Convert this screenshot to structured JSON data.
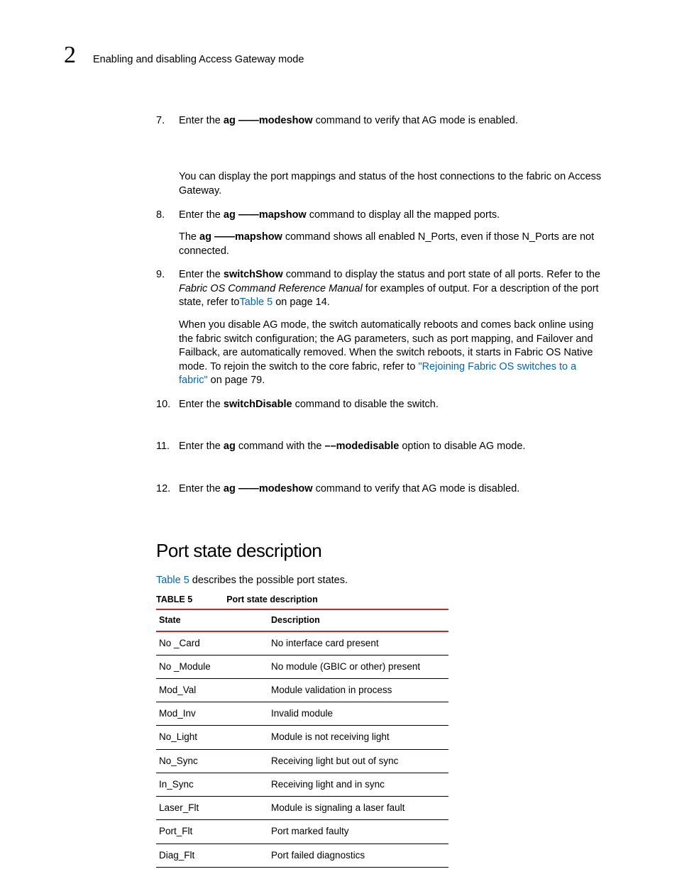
{
  "chapterNumber": "2",
  "headerTitle": "Enabling and disabling Access Gateway mode",
  "steps": [
    {
      "num": "7.",
      "paras": [
        [
          {
            "t": "Enter the "
          },
          {
            "t": "ag ",
            "cls": "bold"
          },
          {
            "t": "——modeshow",
            "cls": "bold"
          },
          {
            "t": " command to verify that AG mode is enabled."
          }
        ],
        [
          {
            "t": "You can display the port mappings and status of the host connections to the fabric on Access Gateway."
          }
        ]
      ],
      "gapAfterFirst": true
    },
    {
      "num": "8.",
      "paras": [
        [
          {
            "t": "Enter the "
          },
          {
            "t": "ag ",
            "cls": "bold"
          },
          {
            "t": "——mapshow",
            "cls": "bold"
          },
          {
            "t": " command to display all the mapped ports."
          }
        ],
        [
          {
            "t": "The "
          },
          {
            "t": "ag ",
            "cls": "bold"
          },
          {
            "t": "——mapshow",
            "cls": "bold"
          },
          {
            "t": " command shows all enabled N_Ports, even if those N_Ports are not connected."
          }
        ]
      ]
    },
    {
      "num": "9.",
      "paras": [
        [
          {
            "t": "Enter the "
          },
          {
            "t": "switchShow",
            "cls": "bold"
          },
          {
            "t": " command to display the status and port state of all ports. Refer to the "
          },
          {
            "t": "Fabric OS Command Reference Manual",
            "cls": "italic"
          },
          {
            "t": " for examples of output. For a description of the port state, refer to"
          },
          {
            "t": "Table 5",
            "cls": "link"
          },
          {
            "t": " on page 14."
          }
        ],
        [
          {
            "t": "When you disable AG mode, the switch automatically reboots and comes back online using the fabric switch configuration; the AG parameters, such as port mapping, and Failover and Failback, are automatically removed. When the switch reboots, it starts in Fabric OS Native mode. To rejoin the switch to the core fabric, refer to "
          },
          {
            "t": "\"Rejoining Fabric OS switches to a fabric\"",
            "cls": "link"
          },
          {
            "t": " on page 79."
          }
        ]
      ]
    },
    {
      "num": "10.",
      "paras": [
        [
          {
            "t": "Enter the "
          },
          {
            "t": "switchDisable",
            "cls": "bold"
          },
          {
            "t": " command to disable the switch."
          }
        ]
      ],
      "extraGap": true
    },
    {
      "num": "11.",
      "paras": [
        [
          {
            "t": "Enter the "
          },
          {
            "t": "ag",
            "cls": "bold"
          },
          {
            "t": " command with the "
          },
          {
            "t": "––modedisable",
            "cls": "bold"
          },
          {
            "t": " option to disable AG mode."
          }
        ]
      ],
      "extraGap": true
    },
    {
      "num": "12.",
      "paras": [
        [
          {
            "t": "Enter the "
          },
          {
            "t": "ag ",
            "cls": "bold"
          },
          {
            "t": "——modeshow",
            "cls": "bold"
          },
          {
            "t": " command to verify that AG mode is disabled."
          }
        ]
      ]
    }
  ],
  "sectionTitle": "Port state description",
  "sectionIntro": [
    {
      "t": "Table 5",
      "cls": "link"
    },
    {
      "t": " describes the possible port states."
    }
  ],
  "tableLabel": "TABLE 5",
  "tableCaption": "Port state description",
  "tableHeaders": {
    "state": "State",
    "desc": "Description"
  },
  "chart_data": {
    "type": "table",
    "columns": [
      "State",
      "Description"
    ],
    "rows": [
      {
        "state": "No _Card",
        "desc": "No interface card present"
      },
      {
        "state": "No _Module",
        "desc": "No module (GBIC or other) present"
      },
      {
        "state": "Mod_Val",
        "desc": "Module validation in process"
      },
      {
        "state": "Mod_Inv",
        "desc": "Invalid module"
      },
      {
        "state": "No_Light",
        "desc": "Module is not receiving light"
      },
      {
        "state": "No_Sync",
        "desc": "Receiving light but out of sync"
      },
      {
        "state": "In_Sync",
        "desc": "Receiving light and in sync"
      },
      {
        "state": "Laser_Flt",
        "desc": "Module is signaling a laser fault"
      },
      {
        "state": "Port_Flt",
        "desc": "Port marked faulty"
      },
      {
        "state": "Diag_Flt",
        "desc": "Port failed diagnostics"
      }
    ]
  }
}
